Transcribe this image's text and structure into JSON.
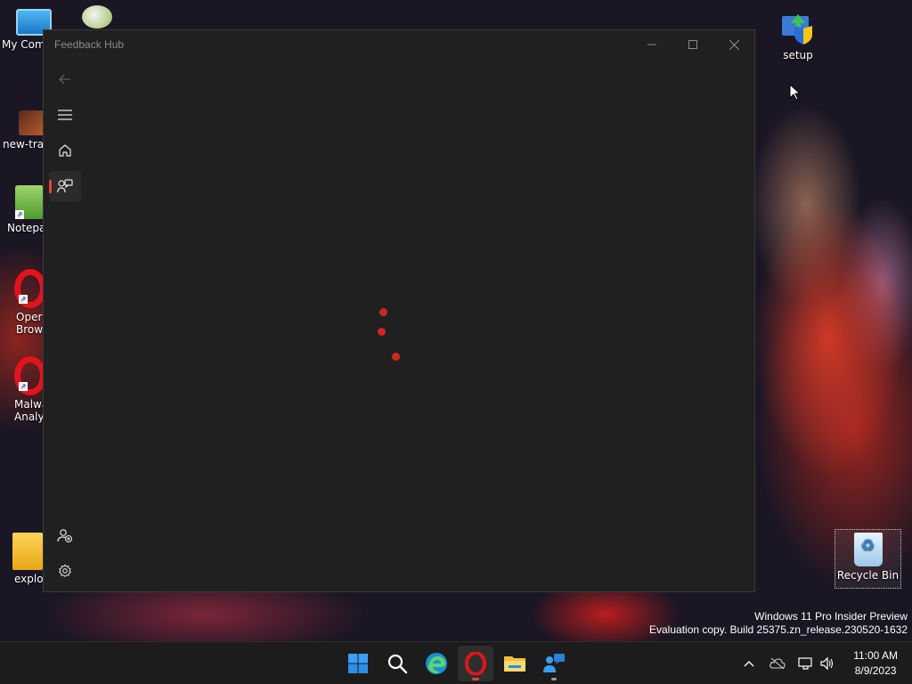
{
  "desktop": {
    "icons": [
      {
        "label": "My Com",
        "icon": "computer-icon"
      },
      {
        "label": "new-trai",
        "icon": "game-icon"
      },
      {
        "label": "Notepa",
        "icon": "notepad-icon"
      },
      {
        "label": "Oper\nBrows",
        "icon": "opera-icon"
      },
      {
        "label": "Malwa\nAnaly",
        "icon": "opera-icon"
      },
      {
        "label": "explor",
        "icon": "folder-icon"
      },
      {
        "label": "setup",
        "icon": "setup-icon"
      },
      {
        "label": "Recycle Bin",
        "icon": "recycle-bin-icon"
      }
    ],
    "watermark": {
      "line1": "Windows 11 Pro Insider Preview",
      "line2": "Evaluation copy. Build 25375.zn_release.230520-1632"
    }
  },
  "window": {
    "title": "Feedback Hub",
    "controls": [
      "minimize-icon",
      "maximize-icon",
      "close-icon"
    ],
    "nav": [
      "back-arrow-icon",
      "hamburger-icon",
      "home-icon",
      "feedback-icon",
      "add-person-icon",
      "gear-icon"
    ],
    "selected_nav": "feedback-icon",
    "content_state": "loading",
    "accent_color": "#d1261e"
  },
  "taskbar": {
    "apps": [
      "start-icon",
      "search-icon",
      "edge-icon",
      "opera-icon",
      "file-explorer-icon",
      "feedback-hub-icon"
    ],
    "tray": [
      "chevron-up-icon",
      "onedrive-icon",
      "network-icon",
      "volume-icon"
    ],
    "clock": {
      "time": "11:00 AM",
      "date": "8/9/2023"
    }
  }
}
